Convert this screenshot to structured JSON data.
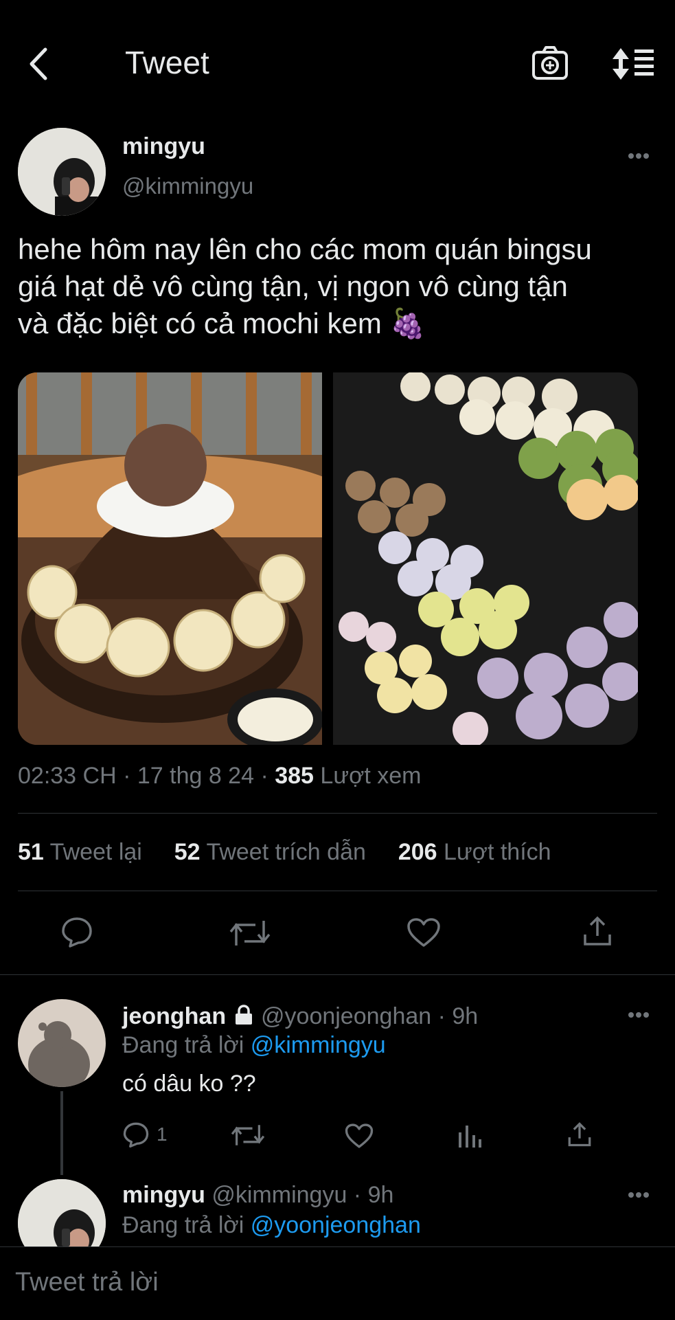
{
  "header": {
    "title": "Tweet",
    "back_icon": "chevron-left-icon",
    "camera_icon": "camera-plus-icon",
    "sort_icon": "sort-icon"
  },
  "tweet": {
    "display_name": "mingyu",
    "handle": "@kimmingyu",
    "text_line1": "hehe hôm nay lên cho các mom quán bingsu",
    "text_line2": "giá hạt dẻ vô cùng tận, vị ngon vô cùng tận",
    "text_line3": "và đặc biệt có cả mochi kem 🍇",
    "time": "02:33 CH · 17 thg 8 24 · ",
    "views_count": "385",
    "views_label": "Lượt xem",
    "retweets_count": "51",
    "retweets_label": "Tweet lại",
    "quotes_count": "52",
    "quotes_label": "Tweet trích dẫn",
    "likes_count": "206",
    "likes_label": "Lượt thích"
  },
  "replies": [
    {
      "display_name": "jeonghan",
      "handle_time": "@yoonjeonghan · 9h",
      "replying_label": "Đang trả lời",
      "replying_to": "@kimmingyu",
      "text": "có dâu ko ??",
      "reply_count": "1"
    },
    {
      "display_name": "mingyu",
      "handle_time": "@kimmingyu · 9h",
      "replying_label": "Đang trả lời",
      "replying_to": "@yoonjeonghan"
    }
  ],
  "composer": {
    "placeholder": "Tweet trả lời"
  }
}
